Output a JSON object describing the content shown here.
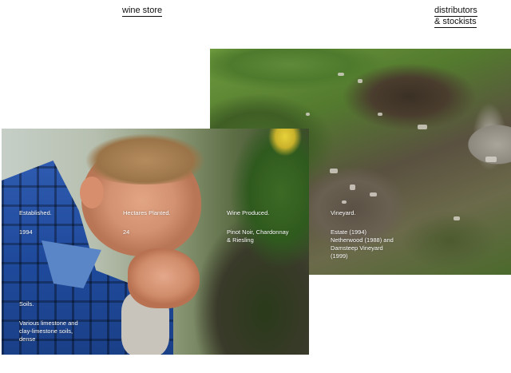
{
  "nav": {
    "wine_store": "wine store",
    "distributors_line1": "distributors",
    "distributors_line2": "& stockists"
  },
  "facts": {
    "established": {
      "label": "Established.",
      "value": "1994"
    },
    "hectares": {
      "label": "Hectares Planted.",
      "value": "24"
    },
    "wine": {
      "label": "Wine Produced.",
      "value": "Pinot Noir, Chardonnay\n& Riesling"
    },
    "vineyard": {
      "label": "Vineyard.",
      "value": "Estate (1994)\nNetherwood (1988) and\nDamsteep Vineyard\n(1999)"
    },
    "soils": {
      "label": "Soils.",
      "value": "Various limestone and\nclay-limestone soils,\ndense"
    }
  }
}
